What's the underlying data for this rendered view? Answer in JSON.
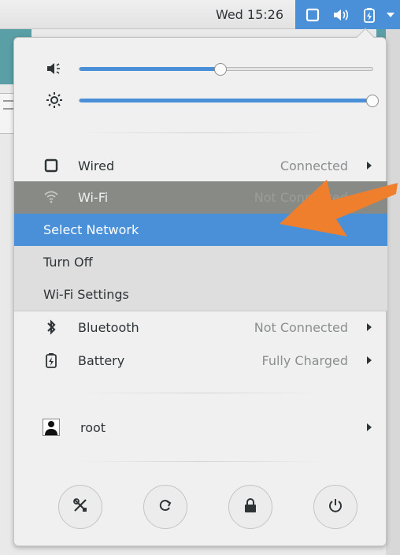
{
  "topbar": {
    "clock": "Wed 15:26",
    "status_icons": [
      "display-icon",
      "volume-icon",
      "battery-icon",
      "chevron-down-icon"
    ]
  },
  "menu": {
    "volume": {
      "icon": "volume-icon",
      "level": 0.48
    },
    "brightness": {
      "icon": "brightness-icon",
      "level": 1.0
    },
    "wired": {
      "label": "Wired",
      "status": "Connected"
    },
    "wifi": {
      "label": "Wi-Fi",
      "status": "Not Connected"
    },
    "wifi_submenu": [
      {
        "label": "Select Network",
        "active": true
      },
      {
        "label": "Turn Off"
      },
      {
        "label": "Wi-Fi Settings"
      }
    ],
    "bluetooth": {
      "label": "Bluetooth",
      "status": "Not Connected"
    },
    "battery": {
      "label": "Battery",
      "status": "Fully Charged"
    },
    "user": {
      "label": "root"
    },
    "actions": [
      "settings-icon",
      "rotation-lock-icon",
      "lock-icon",
      "power-icon"
    ]
  },
  "colors": {
    "accent": "#4a90d9",
    "annotation_arrow": "#f07f2d",
    "wifi_row_bg": "#888a85"
  }
}
